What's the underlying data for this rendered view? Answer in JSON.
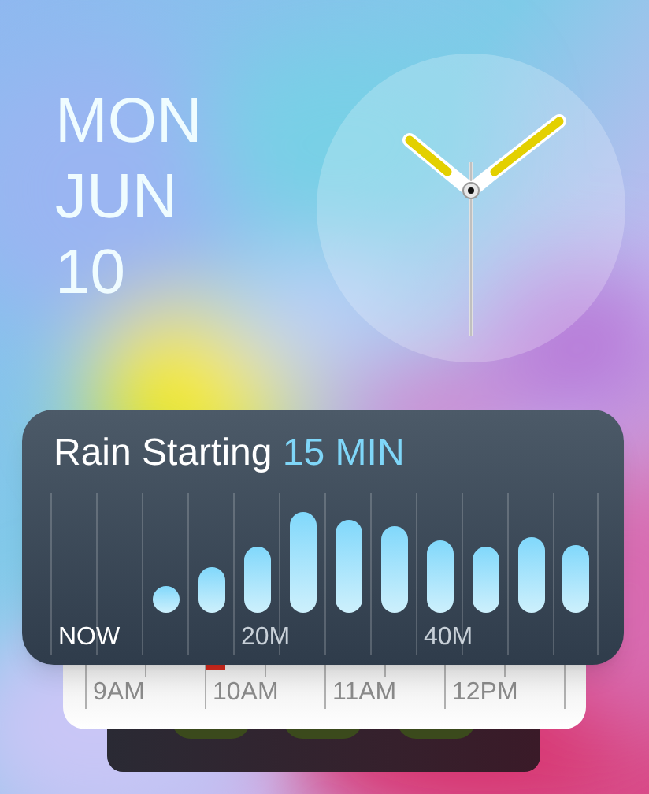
{
  "date": [
    "MON",
    "JUN",
    "10"
  ],
  "rain": {
    "title": "Rain Starting",
    "highlight": "15 MIN",
    "axis_labels": [
      {
        "text": "NOW",
        "highlighted": true
      },
      {
        "text": "20M",
        "highlighted": false
      },
      {
        "text": "40M",
        "highlighted": false
      }
    ]
  },
  "timeline": {
    "hours": [
      "9AM",
      "10AM",
      "11AM",
      "12PM"
    ]
  }
}
